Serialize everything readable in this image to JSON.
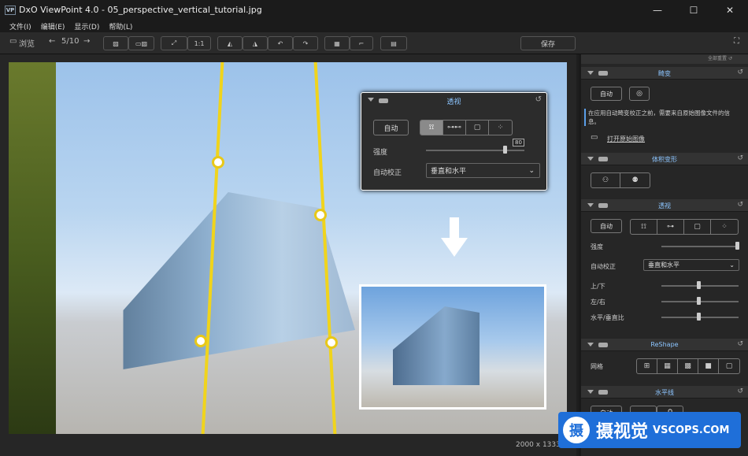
{
  "window": {
    "title": "DxO ViewPoint 4.0 - 05_perspective_vertical_tutorial.jpg",
    "logo": "VP",
    "minimize": "—",
    "maximize": "☐",
    "close": "✕"
  },
  "menu": [
    "文件(I)",
    "编辑(E)",
    "显示(D)",
    "帮助(L)"
  ],
  "toolbar": {
    "browse": "浏览",
    "prev": "←",
    "counter": "5/10",
    "next": "→",
    "ratio": "1:1",
    "save": "保存"
  },
  "image": {
    "dimensions": "2000 x 1333"
  },
  "popup": {
    "title": "透视",
    "auto": "自动",
    "strength_label": "强度",
    "strength_value": "80",
    "strength": 0.8,
    "autocorrect_label": "自动校正",
    "autocorrect_value": "垂直和水平",
    "modes": [
      "⟟⟟",
      "⊶⊷",
      "▢",
      "⁘"
    ]
  },
  "sidebar": {
    "reset_all": "全部重置",
    "distortion": {
      "title": "畸变",
      "auto": "自动",
      "info": "在应用自动畸变校正之前，需要来自原始图像文件的信息。",
      "open_raw": "打开原始图像"
    },
    "volume": {
      "title": "体积变形"
    },
    "perspective": {
      "title": "透视",
      "auto": "自动",
      "strength_label": "强度",
      "strength": 1.0,
      "autocorrect_label": "自动校正",
      "autocorrect_value": "垂直和水平",
      "up_down": "上/下",
      "left_right": "左/右",
      "ratio": "水平/垂直比"
    },
    "reshape": {
      "title": "ReShape",
      "grid_label": "网格"
    },
    "horizon": {
      "title": "水平线",
      "auto": "自动"
    }
  },
  "watermark": {
    "cn": "摄视觉",
    "en": "VSCOPS.COM",
    "icon": "摄"
  }
}
